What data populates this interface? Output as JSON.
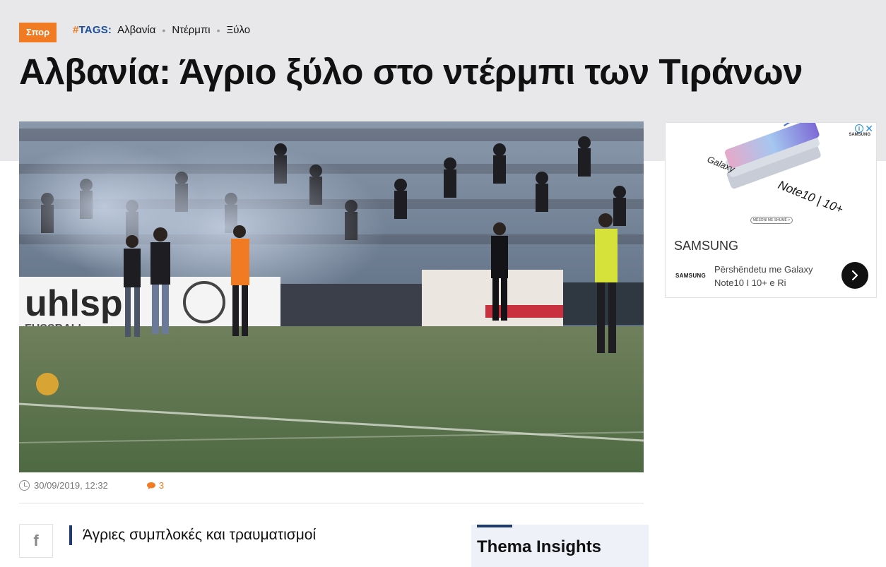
{
  "article": {
    "category": "Σπορ",
    "tags_hash": "#",
    "tags_label": "TAGS:",
    "tags": [
      "Αλβανία",
      "Ντέρμπι",
      "Ξύλο"
    ],
    "title": "Αλβανία: Άγριο ξύλο στο ντέρμπι των Τιράνων",
    "hero_image": {
      "banner_text": "uhlsp",
      "banner_sub": "FUSSBALL"
    },
    "date": "30/09/2019, 12:32",
    "comments_count": "3",
    "related_title": "Άγριες συμπλοκές και τραυματισμοί"
  },
  "sidebar": {
    "insights_title": "Thema Insights"
  },
  "ad": {
    "info_icon": "i",
    "close_icon": "✕",
    "brand_small": "SAMSUNG",
    "product_word1": "Galaxy",
    "product_word2": "Note10 | 10+",
    "cta_small": "MËSONI ME SHUMË >",
    "advertiser": "SAMSUNG",
    "small_logo": "SAMSUNG",
    "text": "Përshëndetu me Galaxy Note10 I 10+ e Ri"
  },
  "colors": {
    "accent": "#f07b22",
    "navy": "#1d3b6e",
    "band": "#e8e7ea"
  }
}
